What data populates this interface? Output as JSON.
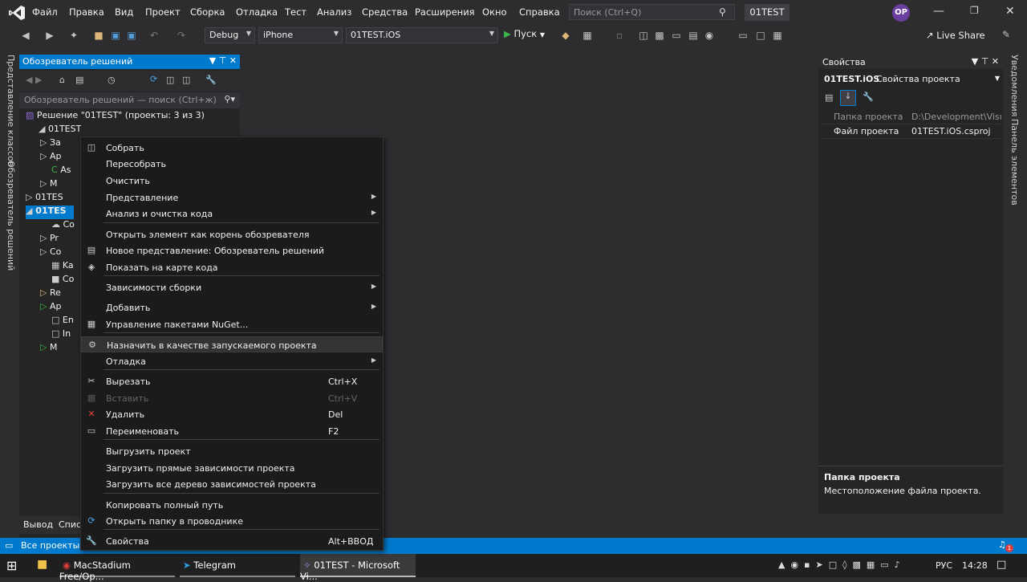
{
  "menubar": {
    "items": [
      "Файл",
      "Правка",
      "Вид",
      "Проект",
      "Сборка",
      "Отладка",
      "Тест",
      "Анализ",
      "Средства",
      "Расширения",
      "Окно",
      "Справка"
    ],
    "search_placeholder": "Поиск (Ctrl+Q)",
    "project_badge": "01TEST",
    "avatar": "OP"
  },
  "toolbar": {
    "config": "Debug",
    "platform": "iPhone",
    "target": "01TEST.iOS",
    "run": "Пуск",
    "liveshare": "Live Share"
  },
  "left_vtabs": {
    "tab1": "Представление классов",
    "tab2": "Обозреватель решений"
  },
  "solution_explorer": {
    "title": "Обозреватель решений",
    "search": "Обозреватель решений — поиск (Ctrl+ж)",
    "solution": "Решение \"01TEST\" (проекты: 3 из 3)",
    "rows": [
      "01TEST",
      "Зa",
      "Ap",
      "As",
      "M",
      "01TES",
      "01TES",
      "Co",
      "Pr",
      "Co",
      "Ka",
      "Co",
      "Re",
      "Ap",
      "En",
      "In",
      "M"
    ],
    "bottom_tab1": "Вывод",
    "bottom_tab2": "Спис"
  },
  "properties": {
    "title": "Свойства",
    "object": "01TEST.iOS",
    "object_type": "Свойства проекта",
    "rows": [
      {
        "name": "Папка проекта",
        "value": "D:\\Development\\Visua"
      },
      {
        "name": "Файл проекта",
        "value": "01TEST.iOS.csproj"
      }
    ],
    "desc_title": "Папка проекта",
    "desc_text": "Местоположение файла проекта."
  },
  "right_vtabs": {
    "tab1": "Уведомления",
    "tab2": "Панель элементов"
  },
  "context_menu": {
    "items": [
      {
        "label": "Собрать",
        "shortcut": "",
        "icon": "build-icon"
      },
      {
        "label": "Пересобрать",
        "shortcut": ""
      },
      {
        "label": "Очистить",
        "shortcut": ""
      },
      {
        "label": "Представление",
        "shortcut": "",
        "sub": true
      },
      {
        "label": "Анализ и очистка кода",
        "shortcut": "",
        "sub": true
      },
      {
        "label": "Открыть элемент как корень обозревателя",
        "shortcut": ""
      },
      {
        "label": "Новое представление: Обозреватель решений",
        "shortcut": "",
        "icon": "new-view-icon"
      },
      {
        "label": "Показать на карте кода",
        "shortcut": "",
        "icon": "code-map-icon"
      },
      {
        "label": "Зависимости сборки",
        "shortcut": "",
        "sub": true
      },
      {
        "label": "Добавить",
        "shortcut": "",
        "sub": true
      },
      {
        "label": "Управление пакетами NuGet...",
        "shortcut": "",
        "icon": "nuget-icon"
      },
      {
        "label": "Назначить в качестве запускаемого проекта",
        "shortcut": "",
        "icon": "gear-icon"
      },
      {
        "label": "Отладка",
        "shortcut": "",
        "sub": true
      },
      {
        "label": "Вырезать",
        "shortcut": "Ctrl+X",
        "icon": "cut-icon"
      },
      {
        "label": "Вставить",
        "shortcut": "Ctrl+V",
        "icon": "paste-icon"
      },
      {
        "label": "Удалить",
        "shortcut": "Del",
        "icon": "delete-icon"
      },
      {
        "label": "Переименовать",
        "shortcut": "F2",
        "icon": "rename-icon"
      },
      {
        "label": "Выгрузить проект",
        "shortcut": ""
      },
      {
        "label": "Загрузить прямые зависимости проекта",
        "shortcut": ""
      },
      {
        "label": "Загрузить все дерево зависимостей проекта",
        "shortcut": ""
      },
      {
        "label": "Копировать полный путь",
        "shortcut": ""
      },
      {
        "label": "Открыть папку в проводнике",
        "shortcut": "",
        "icon": "refresh-icon"
      },
      {
        "label": "Свойства",
        "shortcut": "Alt+ВВОД",
        "icon": "wrench-icon"
      }
    ]
  },
  "statusbar": {
    "text": "Все проекты о",
    "notifications": "1"
  },
  "taskbar": {
    "app1": "MacStadium Free/Op...",
    "app2": "Telegram",
    "app3": "01TEST - Microsoft Vi...",
    "lang": "РУС",
    "time": "14:28"
  },
  "colors": {
    "accent": "#007acc",
    "bg": "#2d2d30",
    "panel": "#252526",
    "menu": "#1b1b1c",
    "delete": "#e03c3c"
  }
}
